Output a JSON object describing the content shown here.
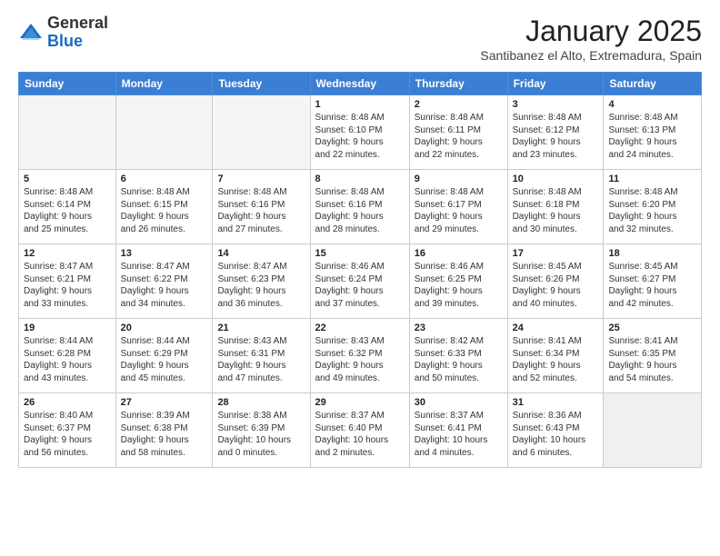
{
  "header": {
    "logo_general": "General",
    "logo_blue": "Blue",
    "month_title": "January 2025",
    "location": "Santibanez el Alto, Extremadura, Spain"
  },
  "weekdays": [
    "Sunday",
    "Monday",
    "Tuesday",
    "Wednesday",
    "Thursday",
    "Friday",
    "Saturday"
  ],
  "weeks": [
    [
      {
        "day": "",
        "info": ""
      },
      {
        "day": "",
        "info": ""
      },
      {
        "day": "",
        "info": ""
      },
      {
        "day": "1",
        "info": "Sunrise: 8:48 AM\nSunset: 6:10 PM\nDaylight: 9 hours\nand 22 minutes."
      },
      {
        "day": "2",
        "info": "Sunrise: 8:48 AM\nSunset: 6:11 PM\nDaylight: 9 hours\nand 22 minutes."
      },
      {
        "day": "3",
        "info": "Sunrise: 8:48 AM\nSunset: 6:12 PM\nDaylight: 9 hours\nand 23 minutes."
      },
      {
        "day": "4",
        "info": "Sunrise: 8:48 AM\nSunset: 6:13 PM\nDaylight: 9 hours\nand 24 minutes."
      }
    ],
    [
      {
        "day": "5",
        "info": "Sunrise: 8:48 AM\nSunset: 6:14 PM\nDaylight: 9 hours\nand 25 minutes."
      },
      {
        "day": "6",
        "info": "Sunrise: 8:48 AM\nSunset: 6:15 PM\nDaylight: 9 hours\nand 26 minutes."
      },
      {
        "day": "7",
        "info": "Sunrise: 8:48 AM\nSunset: 6:16 PM\nDaylight: 9 hours\nand 27 minutes."
      },
      {
        "day": "8",
        "info": "Sunrise: 8:48 AM\nSunset: 6:16 PM\nDaylight: 9 hours\nand 28 minutes."
      },
      {
        "day": "9",
        "info": "Sunrise: 8:48 AM\nSunset: 6:17 PM\nDaylight: 9 hours\nand 29 minutes."
      },
      {
        "day": "10",
        "info": "Sunrise: 8:48 AM\nSunset: 6:18 PM\nDaylight: 9 hours\nand 30 minutes."
      },
      {
        "day": "11",
        "info": "Sunrise: 8:48 AM\nSunset: 6:20 PM\nDaylight: 9 hours\nand 32 minutes."
      }
    ],
    [
      {
        "day": "12",
        "info": "Sunrise: 8:47 AM\nSunset: 6:21 PM\nDaylight: 9 hours\nand 33 minutes."
      },
      {
        "day": "13",
        "info": "Sunrise: 8:47 AM\nSunset: 6:22 PM\nDaylight: 9 hours\nand 34 minutes."
      },
      {
        "day": "14",
        "info": "Sunrise: 8:47 AM\nSunset: 6:23 PM\nDaylight: 9 hours\nand 36 minutes."
      },
      {
        "day": "15",
        "info": "Sunrise: 8:46 AM\nSunset: 6:24 PM\nDaylight: 9 hours\nand 37 minutes."
      },
      {
        "day": "16",
        "info": "Sunrise: 8:46 AM\nSunset: 6:25 PM\nDaylight: 9 hours\nand 39 minutes."
      },
      {
        "day": "17",
        "info": "Sunrise: 8:45 AM\nSunset: 6:26 PM\nDaylight: 9 hours\nand 40 minutes."
      },
      {
        "day": "18",
        "info": "Sunrise: 8:45 AM\nSunset: 6:27 PM\nDaylight: 9 hours\nand 42 minutes."
      }
    ],
    [
      {
        "day": "19",
        "info": "Sunrise: 8:44 AM\nSunset: 6:28 PM\nDaylight: 9 hours\nand 43 minutes."
      },
      {
        "day": "20",
        "info": "Sunrise: 8:44 AM\nSunset: 6:29 PM\nDaylight: 9 hours\nand 45 minutes."
      },
      {
        "day": "21",
        "info": "Sunrise: 8:43 AM\nSunset: 6:31 PM\nDaylight: 9 hours\nand 47 minutes."
      },
      {
        "day": "22",
        "info": "Sunrise: 8:43 AM\nSunset: 6:32 PM\nDaylight: 9 hours\nand 49 minutes."
      },
      {
        "day": "23",
        "info": "Sunrise: 8:42 AM\nSunset: 6:33 PM\nDaylight: 9 hours\nand 50 minutes."
      },
      {
        "day": "24",
        "info": "Sunrise: 8:41 AM\nSunset: 6:34 PM\nDaylight: 9 hours\nand 52 minutes."
      },
      {
        "day": "25",
        "info": "Sunrise: 8:41 AM\nSunset: 6:35 PM\nDaylight: 9 hours\nand 54 minutes."
      }
    ],
    [
      {
        "day": "26",
        "info": "Sunrise: 8:40 AM\nSunset: 6:37 PM\nDaylight: 9 hours\nand 56 minutes."
      },
      {
        "day": "27",
        "info": "Sunrise: 8:39 AM\nSunset: 6:38 PM\nDaylight: 9 hours\nand 58 minutes."
      },
      {
        "day": "28",
        "info": "Sunrise: 8:38 AM\nSunset: 6:39 PM\nDaylight: 10 hours\nand 0 minutes."
      },
      {
        "day": "29",
        "info": "Sunrise: 8:37 AM\nSunset: 6:40 PM\nDaylight: 10 hours\nand 2 minutes."
      },
      {
        "day": "30",
        "info": "Sunrise: 8:37 AM\nSunset: 6:41 PM\nDaylight: 10 hours\nand 4 minutes."
      },
      {
        "day": "31",
        "info": "Sunrise: 8:36 AM\nSunset: 6:43 PM\nDaylight: 10 hours\nand 6 minutes."
      },
      {
        "day": "",
        "info": ""
      }
    ]
  ]
}
